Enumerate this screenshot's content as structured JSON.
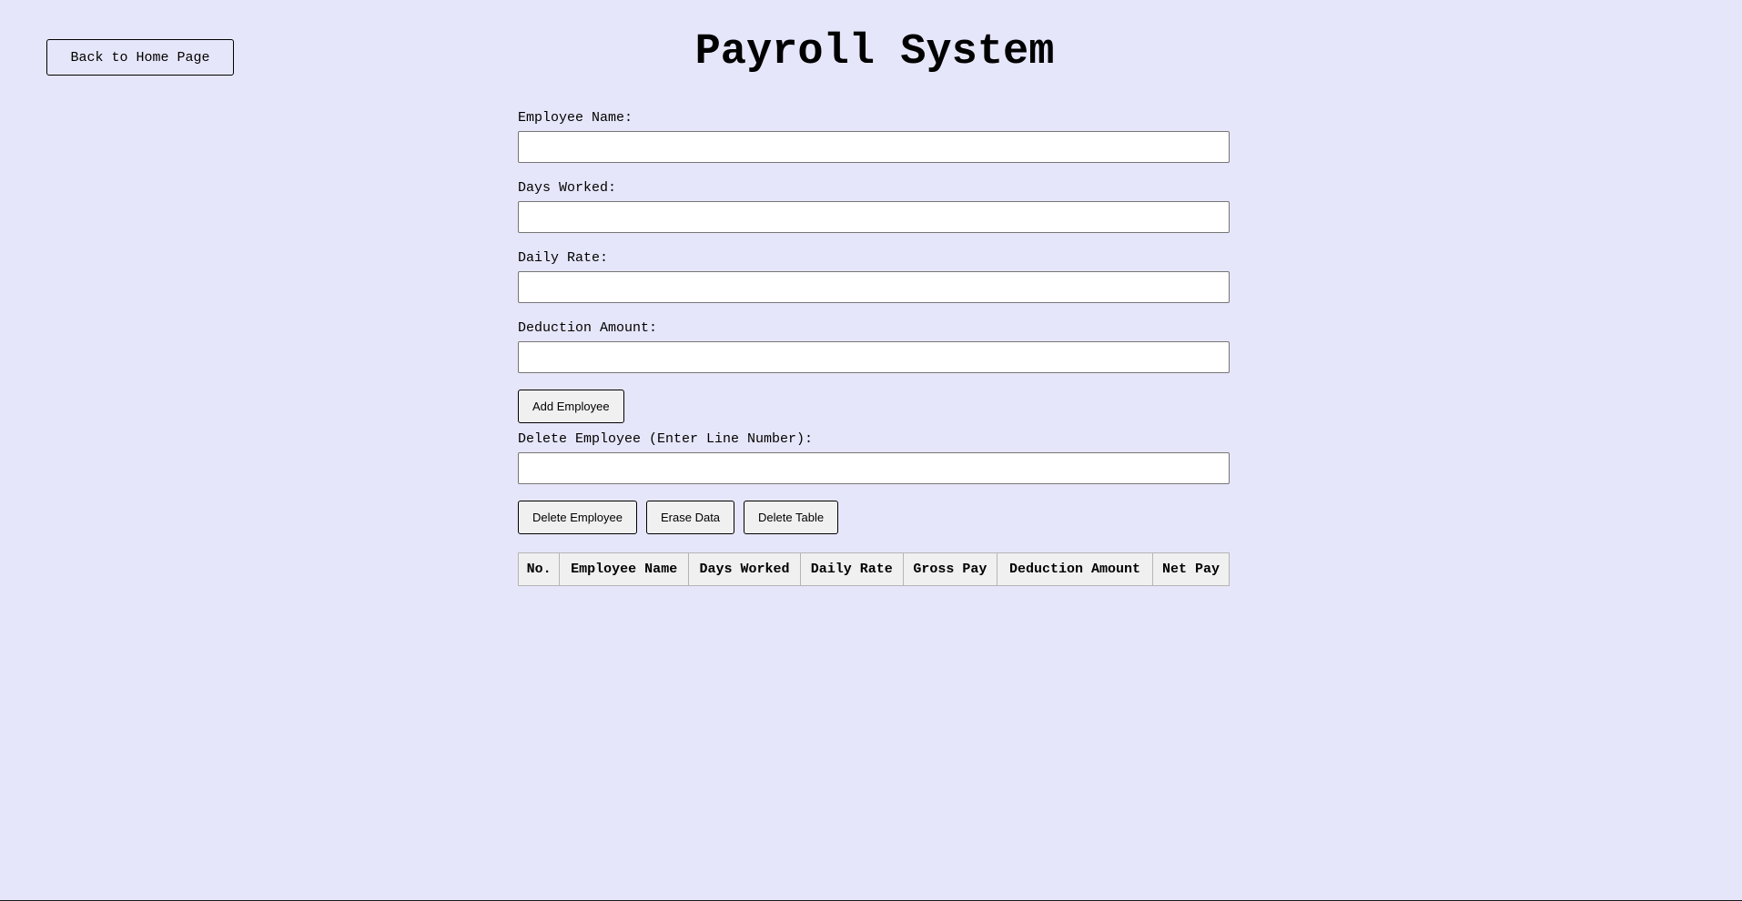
{
  "header": {
    "home_button_label": "Back to Home Page",
    "title": "Payroll System"
  },
  "form": {
    "employee_name_label": "Employee Name:",
    "employee_name_value": "",
    "days_worked_label": "Days Worked:",
    "days_worked_value": "",
    "daily_rate_label": "Daily Rate:",
    "daily_rate_value": "",
    "deduction_amount_label": "Deduction Amount:",
    "deduction_amount_value": "",
    "add_button_label": "Add Employee",
    "delete_line_label": "Delete Employee (Enter Line Number):",
    "delete_line_value": ""
  },
  "actions": {
    "delete_employee_label": "Delete Employee",
    "erase_data_label": "Erase Data",
    "delete_table_label": "Delete Table"
  },
  "table": {
    "columns": [
      "No.",
      "Employee Name",
      "Days Worked",
      "Daily Rate",
      "Gross Pay",
      "Deduction Amount",
      "Net Pay"
    ],
    "rows": []
  },
  "colors": {
    "background": "#e6e6fa",
    "button_background": "#f0f0f0",
    "input_background": "#ffffff",
    "input_border": "#767676",
    "table_border": "#b5b5b5"
  }
}
